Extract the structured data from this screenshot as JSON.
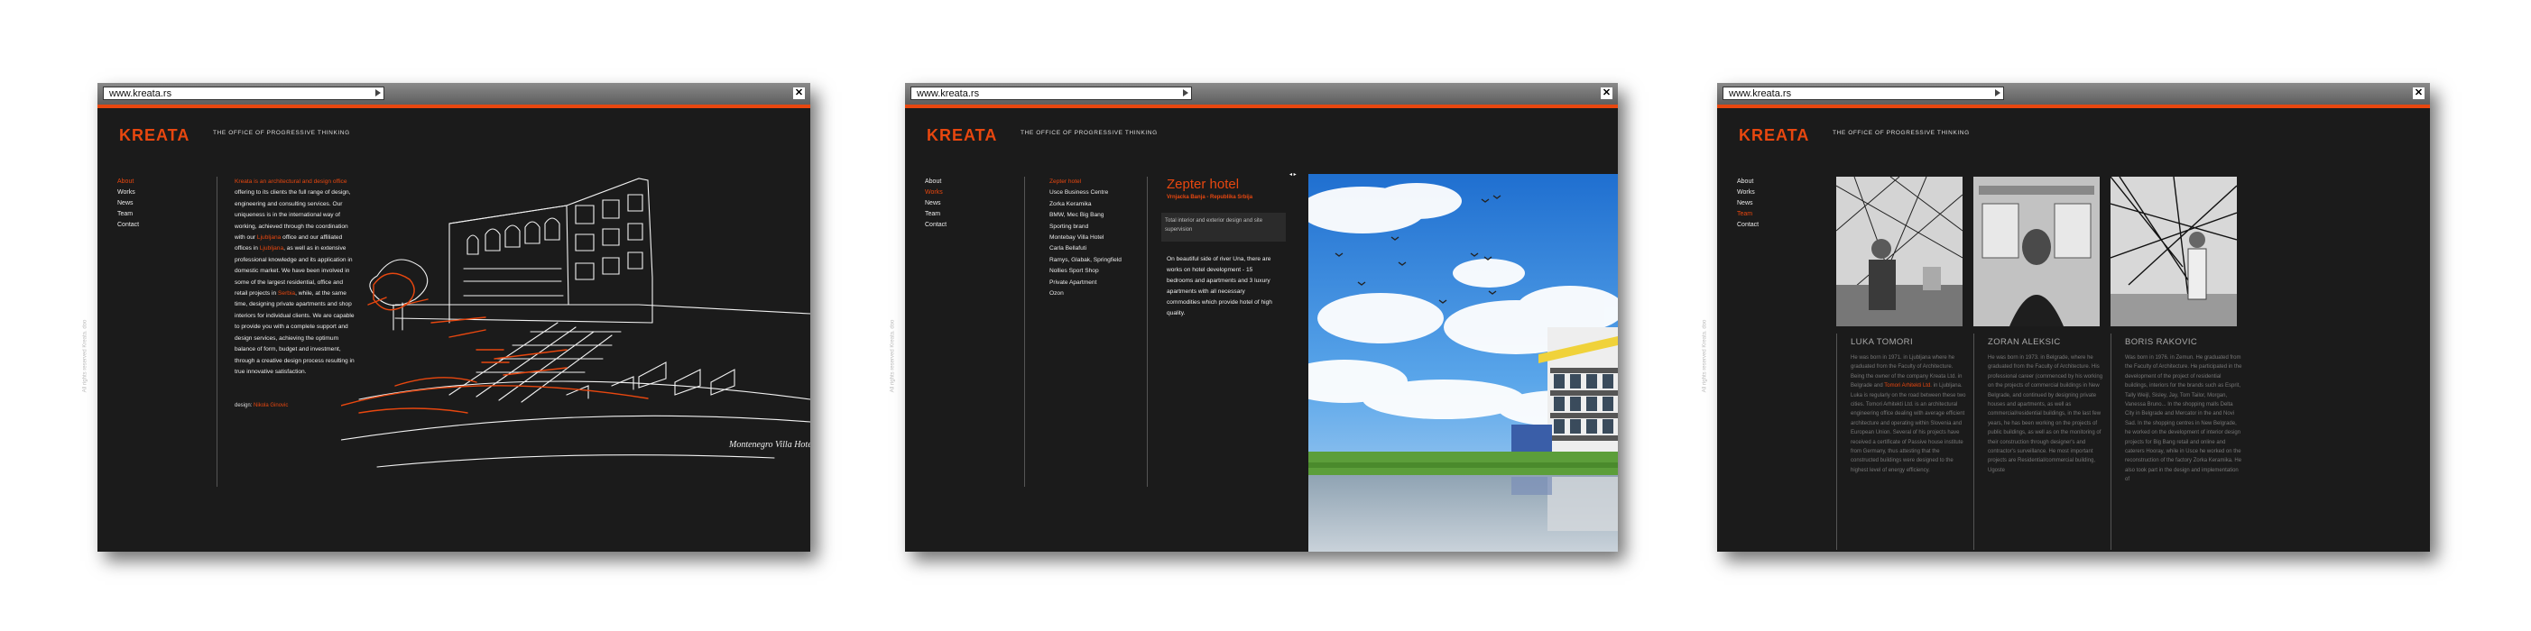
{
  "windows": [
    {
      "url": "www.kreata.rs",
      "logo": "KREATA",
      "tagline": "THE OFFICE OF PROGRESSIVE THINKING",
      "nav": [
        "About",
        "Works",
        "News",
        "Team",
        "Contact"
      ],
      "side_text": "All rights reserved Kreata. doo",
      "about": {
        "highlight": "Kreata is an architectural and design office",
        "p1": " offering to its clients the full range of design, engineering and consulting services. Our uniqueness is in the international way of working, achieved through the coordination with our ",
        "ljubljana1": "Ljubljana",
        "p2": " office and our affiliated offices in ",
        "ljubljana2": "Ljubljana",
        "p3": ", as well as in extensive professional knowledge and its application in domestic market. We have been involved in some of the largest residential, office and retail projects in ",
        "serbia": "Serbia",
        "p4": ", while, at the same time, designing private apartments and shop interiors for individual clients. We are capable to provide you with a complete support and design services, achieving the optimum balance of form, budget and investment, through a creative design process resulting in true innovative satisfaction.",
        "design_label": "design:",
        "design_name": "Nikola Ginovic"
      },
      "sketch_caption": "Montenegro Villa Hotel"
    },
    {
      "url": "www.kreata.rs",
      "logo": "KREATA",
      "tagline": "THE OFFICE OF PROGRESSIVE THINKING",
      "nav": [
        "About",
        "Works",
        "News",
        "Team",
        "Contact"
      ],
      "side_text": "All rights reserved Kreata. doo",
      "projects": [
        "Zepter hotel",
        "Usce Business Centre",
        "Zorka Keramika",
        "BMW, Mec Big Bang",
        "Sporting brand",
        "Montebay Villa Hotel",
        "Carla Bellafuti",
        "Ramys, Glabak, Springfield",
        "Nollies Sport Shop",
        "Private Apartment",
        "Ozon"
      ],
      "project": {
        "title": "Zepter hotel",
        "subtitle": "Vrnjacka Banja - Republika Srbija",
        "box": "Total interior and exterior design and site supervision",
        "desc": "On beautiful side of river Una, there are works on hotel development - 15 bedrooms and apartments and 3 luxury apartments with all necessary commodities which provide hotel of high quality."
      }
    },
    {
      "url": "www.kreata.rs",
      "logo": "KREATA",
      "tagline": "THE OFFICE OF PROGRESSIVE THINKING",
      "nav": [
        "About",
        "Works",
        "News",
        "Team",
        "Contact"
      ],
      "side_text": "All rights reserved Kreata. doo",
      "team": [
        {
          "name": "LUKA TOMORI",
          "bio_a": "He was born in 1971. in Ljubljana where he graduated from the Faculty of Architecture. Being the owner of the company Kreata Ltd. in Belgrade and ",
          "bio_hl": "Tomori Arhitekti Ltd.",
          "bio_b": " in Ljubljana. Luka is regularly on the road between these two cities. Tomori Arhitekti Ltd. is an architectural engineering office dealing with average efficient architecture and operating within Slovenia and European Union. Several of his projects have received a certificate of Passive house institute from Germany, thus attesting that the constructed buildings were designed to the highest level of energy efficiency."
        },
        {
          "name": "ZORAN ALEKSIC",
          "bio_a": "He was born in 1973. in Belgrade, where he graduated from the Faculty of Architecture. His professional career (commenced by his working on the projects of commercial buildings in New Belgrade, and continued by designing private houses and apartments, as well as commercial/residential buildings, in the last few years, he has been working on the projects of public buildings, as well as on the monitoring of their construction through designer's and contractor's surveillance. He most important projects are Residential/commercial building, Ugoste",
          "bio_hl": "",
          "bio_b": ""
        },
        {
          "name": "BORIS RAKOVIC",
          "bio_a": "Was born in 1976. in Zemun. He graduated from the Faculty of Architecture. He participated in the development of the project of residential buildings, interiors for the brands such as Esprit, Tally Weijl, Sisley, Jay, Tom Tailor, Morgan, Vanessa Bruno... In the shopping malls Delta City in Belgrade and Mercator in the and Novi Sad. In the shopping centres in New Belgrade, he worked on the development of interior design projects for Big Bang retail and online and caterers Hooray, while in Usce he worked on the reconstruction of the factory Zorka Keramika. He also took part in the design and implementation of",
          "bio_hl": "",
          "bio_b": ""
        }
      ]
    }
  ]
}
